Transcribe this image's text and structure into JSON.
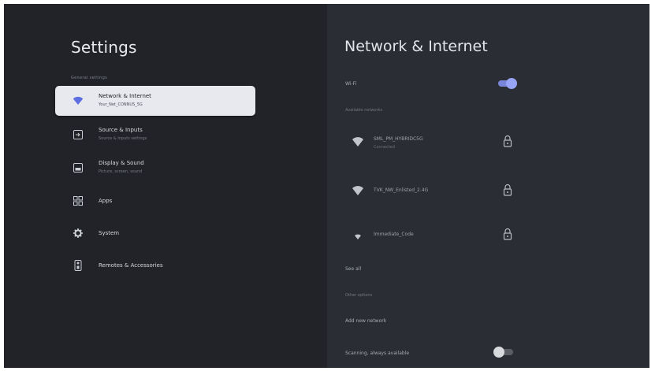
{
  "settings": {
    "title": "Settings",
    "section_label": "General settings",
    "items": [
      {
        "label": "Network & Internet",
        "sub": "Your_Net_CONNUS_5G",
        "icon": "wifi-icon",
        "selected": true
      },
      {
        "label": "Source & Inputs",
        "sub": "Source & Inputs settings",
        "icon": "input-source-icon"
      },
      {
        "label": "Display & Sound",
        "sub": "Picture, screen, sound",
        "icon": "display-icon"
      },
      {
        "label": "Apps",
        "sub": "",
        "icon": "apps-icon"
      },
      {
        "label": "System",
        "sub": "",
        "icon": "gear-icon"
      },
      {
        "label": "Remotes & Accessories",
        "sub": "",
        "icon": "remote-icon"
      }
    ]
  },
  "network": {
    "title": "Network & Internet",
    "wifi_label": "Wi-Fi",
    "wifi_on": true,
    "available_label": "Available networks",
    "networks": [
      {
        "name": "SML_PM_HYBRIDC5G",
        "status": "Connected",
        "locked": true
      },
      {
        "name": "TVK_NW_Enlisted_2.4G",
        "status": "",
        "locked": true
      },
      {
        "name": "Immediate_Code",
        "status": "",
        "locked": true
      }
    ],
    "see_all": "See all",
    "other_options_label": "Other options",
    "add_network": "Add new network",
    "scanning_label": "Scanning, always available",
    "scanning_on": false
  },
  "colors": {
    "accent": "#8b96ee",
    "selected_bg": "#e7e9ee"
  }
}
